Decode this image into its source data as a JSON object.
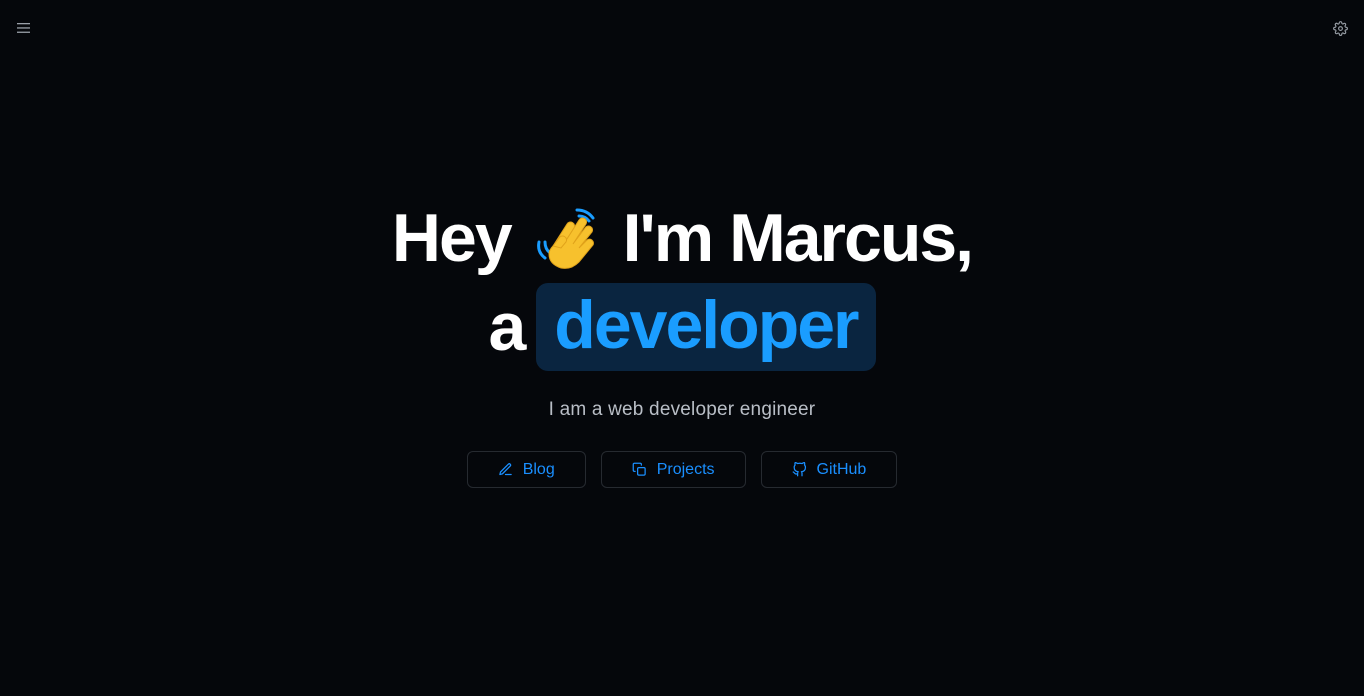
{
  "header": {
    "menu_icon": "hamburger-menu-icon",
    "settings_icon": "gear-icon"
  },
  "hero": {
    "greeting_hey": "Hey",
    "greeting_emoji": "waving-hand-icon",
    "greeting_name": "I'm Marcus,",
    "article": "a",
    "role": "developer",
    "subtitle": "I am a web developer engineer"
  },
  "actions": [
    {
      "label": "Blog",
      "icon": "pencil-icon"
    },
    {
      "label": "Projects",
      "icon": "copy-icon"
    },
    {
      "label": "GitHub",
      "icon": "github-icon"
    }
  ],
  "colors": {
    "background": "#05070b",
    "accent": "#1a9dff",
    "pill_background": "#0a2540",
    "text": "#ffffff",
    "muted": "#b9bec6"
  }
}
